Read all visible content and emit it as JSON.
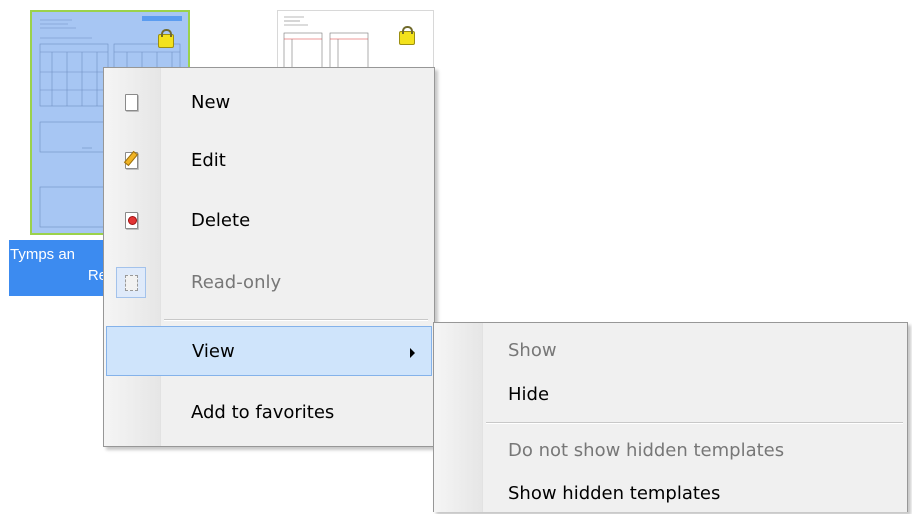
{
  "thumbnails": [
    {
      "name": "tymps-template",
      "label_line1": "Tymps an",
      "label_line2": "Re",
      "selected": true
    },
    {
      "name": "second-template",
      "selected": false
    }
  ],
  "context_menu": {
    "items": [
      {
        "label": "New",
        "icon": "new-document-icon",
        "enabled": true
      },
      {
        "label": "Edit",
        "icon": "edit-pencil-icon",
        "enabled": true
      },
      {
        "label": "Delete",
        "icon": "delete-icon",
        "enabled": true
      },
      {
        "label": "Read-only",
        "icon": "read-only-icon",
        "enabled": false,
        "checked": true
      },
      {
        "label": "View",
        "icon": "",
        "enabled": true,
        "highlighted": true,
        "has_submenu": true
      },
      {
        "label": "Add to favorites",
        "icon": "",
        "enabled": true
      }
    ]
  },
  "view_submenu": {
    "items": [
      {
        "label": "Show",
        "enabled": false
      },
      {
        "label": "Hide",
        "enabled": true
      },
      {
        "label": "Do not show hidden templates",
        "enabled": false
      },
      {
        "label": "Show hidden templates",
        "enabled": true
      }
    ]
  },
  "colors": {
    "selection": "#3c8bf0",
    "thumb_selected_bg": "#a7c6f3",
    "thumb_selected_border": "#9bd24b",
    "menu_bg": "#f0f0f0",
    "menu_highlight": "#cfe4fb",
    "lock": "#f3e21c"
  }
}
